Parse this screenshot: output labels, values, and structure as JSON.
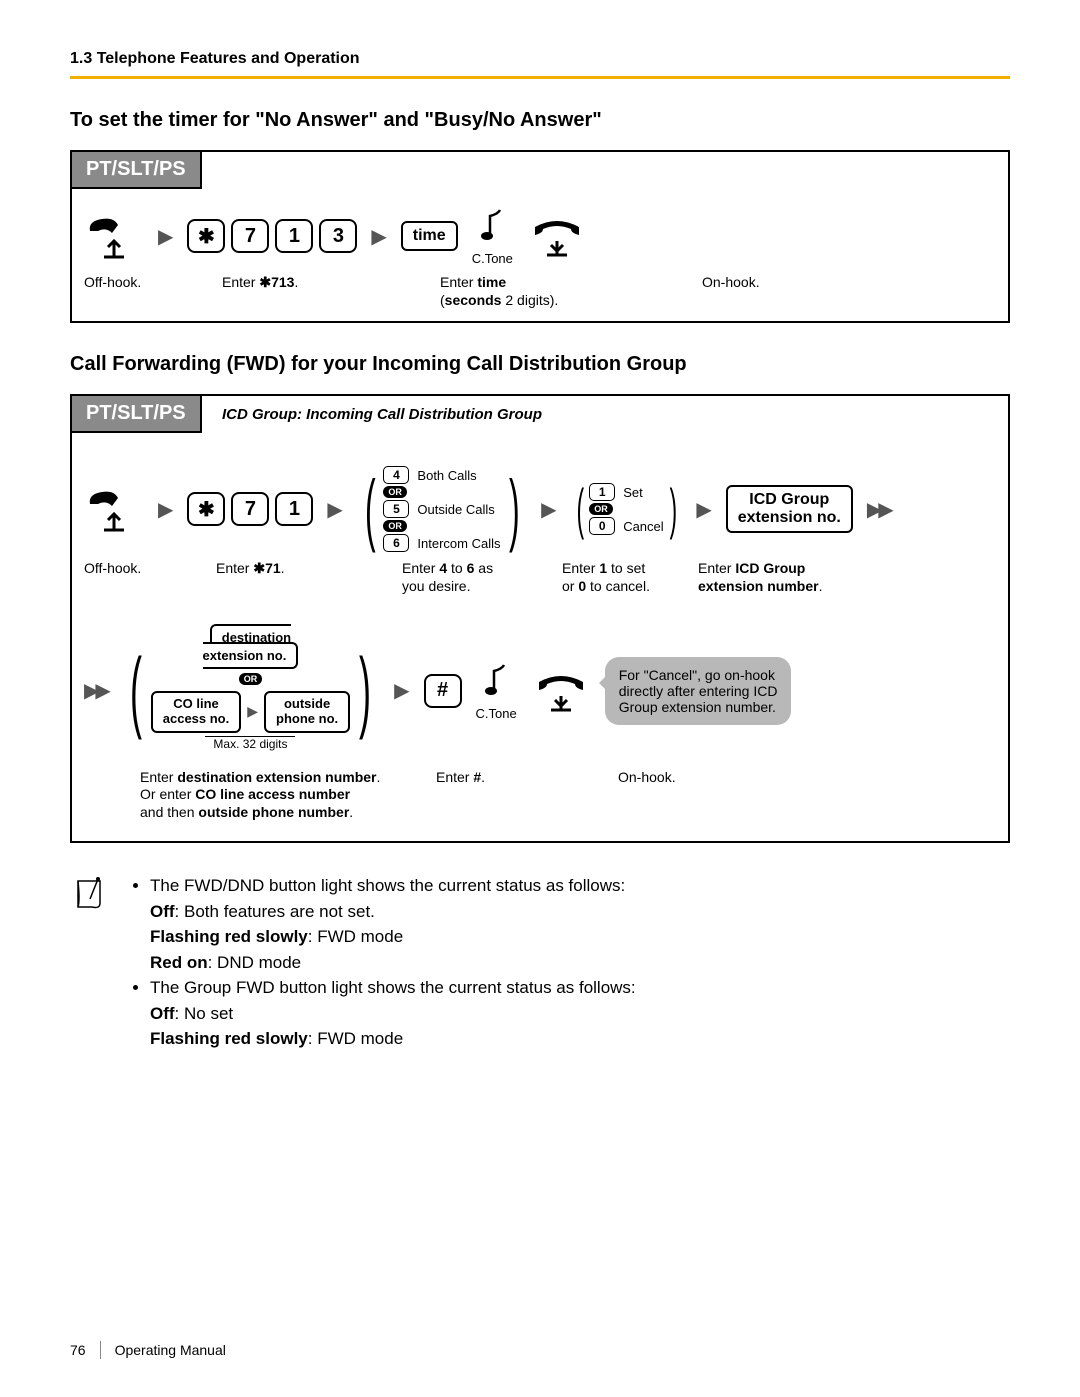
{
  "header": {
    "section": "1.3 Telephone Features and Operation"
  },
  "h_timer": "To set the timer for \"No Answer\" and \"Busy/No Answer\"",
  "h_fwd": "Call Forwarding (FWD) for your Incoming Call Distribution Group",
  "tab": "PT/SLT/PS",
  "icd_note": "ICD Group: Incoming Call Distribution Group",
  "keys": {
    "star": "✱",
    "7": "7",
    "1": "1",
    "3": "3",
    "hash": "#"
  },
  "labels": {
    "time": "time",
    "ctone": "C.Tone",
    "offhook": "Off-hook.",
    "onhook": "On-hook.",
    "enter713": "Enter ✱713.",
    "entertime1": "Enter time",
    "entertime2": "(seconds 2 digits).",
    "enter71": "Enter ✱71.",
    "enter46a": "Enter 4 to 6 as",
    "enter46b": "you desire.",
    "enter10a": "Enter 1 to set",
    "enter10b": "or 0 to cancel.",
    "entericd1": "Enter ICD Group",
    "entericd2": "extension number.",
    "icdgroup1": "ICD Group",
    "icdgroup2": "extension no.",
    "dest1": "destination",
    "dest2": "extension no.",
    "co1": "CO line",
    "co2": "access no.",
    "out1": "outside",
    "out2": "phone no.",
    "max32": "Max. 32 digits",
    "opt4": "Both Calls",
    "opt5": "Outside Calls",
    "opt6": "Intercom Calls",
    "set": "Set",
    "cancel": "Cancel",
    "or": "OR",
    "enterhash": "Enter #.",
    "enterdest1": "Enter destination extension number.",
    "enterdest2": "Or enter CO line access number",
    "enterdest3": "and then outside phone number."
  },
  "bubble": {
    "l1": "For \"Cancel\", go on-hook",
    "l2": "directly after entering ICD",
    "l3": "Group extension number."
  },
  "notes": {
    "n1": "The FWD/DND button light shows the current status as follows:",
    "n1a": "Off: Both features are not set.",
    "n1b": "Flashing red slowly: FWD mode",
    "n1c": "Red on: DND mode",
    "n2": "The Group FWD button light shows the current status as follows:",
    "n2a": "Off: No set",
    "n2b": "Flashing red slowly: FWD mode"
  },
  "footer": {
    "page": "76",
    "title": "Operating Manual"
  }
}
